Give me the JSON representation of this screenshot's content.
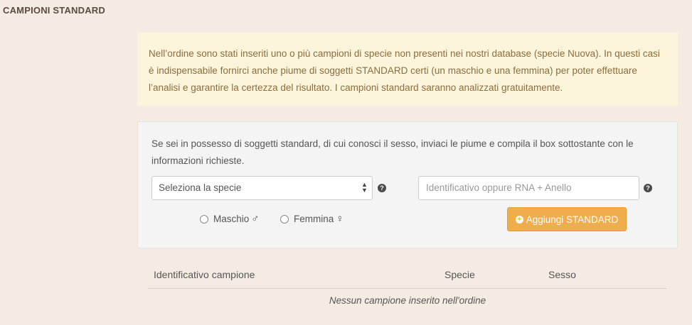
{
  "section": {
    "title": "CAMPIONI STANDARD"
  },
  "alert": {
    "text": "Nell’ordine sono stati inseriti uno o più campioni di specie non presenti nei nostri database (specie Nuova). In questi casi è indispensabile fornirci anche piume di soggetti STANDARD certi (un maschio e una femmina) per poter effettuare l’analisi e garantire la certezza del risultato. I campioni standard saranno analizzati gratuitamente."
  },
  "form": {
    "intro": "Se sei in possesso di soggetti standard, di cui conosci il sesso, inviaci le piume e compila il box sottostante con le informazioni richieste.",
    "species_select": {
      "value": "Seleziona la specie"
    },
    "id_input": {
      "placeholder": "Identificativo oppure RNA + Anello"
    },
    "sex_options": [
      {
        "label": "Maschio",
        "symbol": "♂",
        "selected": false
      },
      {
        "label": "Femmina",
        "symbol": "♀",
        "selected": false
      }
    ],
    "add_button": {
      "label": "Aggiungi STANDARD"
    }
  },
  "table": {
    "columns": [
      "Identificativo campione",
      "Specie",
      "Sesso"
    ],
    "empty_text": "Nessun campione inserito nell'ordine"
  }
}
